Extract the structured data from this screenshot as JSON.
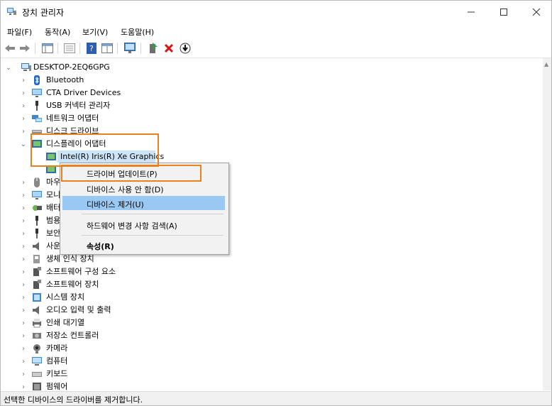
{
  "window": {
    "title": "장치 관리자"
  },
  "menu": [
    "파일(F)",
    "동작(A)",
    "보기(V)",
    "도움말(H)"
  ],
  "tree": {
    "root": "DESKTOP-2EQ6GPG",
    "items": [
      {
        "label": "Bluetooth",
        "icon": "bluetooth-icon"
      },
      {
        "label": "CTA Driver Devices",
        "icon": "monitor-icon"
      },
      {
        "label": "USB 커넥터 관리자",
        "icon": "usb-icon"
      },
      {
        "label": "네트워크 어댑터",
        "icon": "network-icon"
      },
      {
        "label": "디스크 드라이브",
        "icon": "disk-icon"
      },
      {
        "label": "디스플레이 어댑터",
        "icon": "display-adapter-icon"
      },
      {
        "label": "Intel(R) Iris(R) Xe Graphics",
        "icon": "display-adapter-icon"
      },
      {
        "label": "",
        "icon": "display-adapter-icon"
      },
      {
        "label": "마우",
        "icon": "mouse-icon"
      },
      {
        "label": "모니",
        "icon": "monitor-icon"
      },
      {
        "label": "배터",
        "icon": "battery-icon"
      },
      {
        "label": "범용",
        "icon": "usb-icon"
      },
      {
        "label": "보안",
        "icon": "security-icon"
      },
      {
        "label": "사운",
        "icon": "speaker-icon"
      },
      {
        "label": "생체 인식 장치",
        "icon": "biometric-icon"
      },
      {
        "label": "소프트웨어 구성 요소",
        "icon": "component-icon"
      },
      {
        "label": "소프트웨어 장치",
        "icon": "component-icon"
      },
      {
        "label": "시스템 장치",
        "icon": "system-icon"
      },
      {
        "label": "오디오 입력 및 출력",
        "icon": "speaker-icon"
      },
      {
        "label": "인쇄 대기열",
        "icon": "printer-icon"
      },
      {
        "label": "저장소 컨트롤러",
        "icon": "storage-icon"
      },
      {
        "label": "카메라",
        "icon": "camera-icon"
      },
      {
        "label": "컴퓨터",
        "icon": "computer-icon"
      },
      {
        "label": "키보드",
        "icon": "keyboard-icon"
      },
      {
        "label": "펌웨어",
        "icon": "firmware-icon"
      }
    ]
  },
  "context_menu": {
    "items": [
      "드라이버 업데이트(P)",
      "디바이스 사용 안 함(D)",
      "디바이스 제거(U)",
      "하드웨어 변경 사항 검색(A)",
      "속성(R)"
    ],
    "highlighted": "디바이스 제거(U)"
  },
  "status_bar": "선택한 디바이스의 드라이버를 제거합니다.",
  "colors": {
    "highlight": "#e8821e",
    "selection": "#99c9f3",
    "tree_selected": "#cce4f7"
  }
}
